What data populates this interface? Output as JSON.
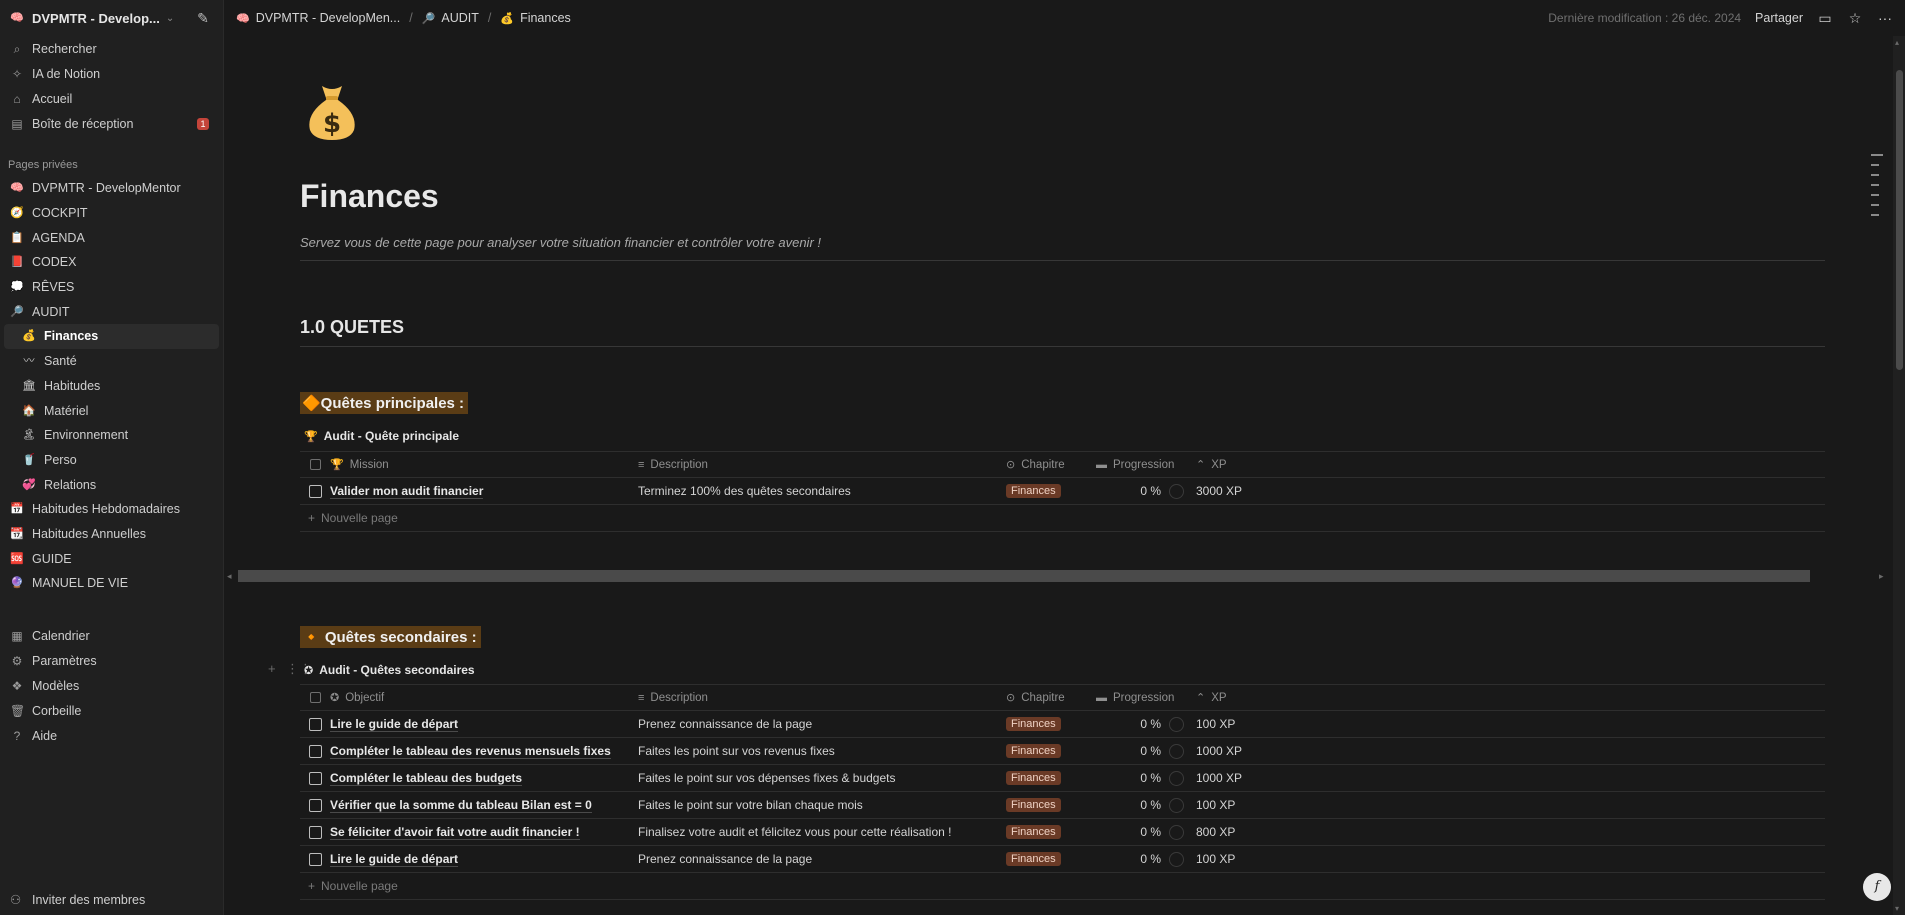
{
  "workspace": {
    "name": "DVPMTR - Develop...",
    "icon": "brain-icon"
  },
  "sidebar": {
    "top_items": [
      {
        "label": "Rechercher",
        "icon": "search-icon"
      },
      {
        "label": "IA de Notion",
        "icon": "ai-icon"
      },
      {
        "label": "Accueil",
        "icon": "home-icon"
      },
      {
        "label": "Boîte de réception",
        "icon": "inbox-icon",
        "badge": "1"
      }
    ],
    "section_label": "Pages privées",
    "tree": [
      {
        "label": "DVPMTR - DevelopMentor",
        "emoji": "🧠",
        "level": 0
      },
      {
        "label": "COCKPIT",
        "emoji": "🧭",
        "level": 1
      },
      {
        "label": "AGENDA",
        "emoji": "📋",
        "level": 1
      },
      {
        "label": "CODEX",
        "emoji": "📕",
        "level": 1
      },
      {
        "label": "RÊVES",
        "emoji": "💭",
        "level": 1
      },
      {
        "label": "AUDIT",
        "emoji": "🔎",
        "level": 1
      },
      {
        "label": "Finances",
        "emoji": "💰",
        "level": 2,
        "active": true
      },
      {
        "label": "Santé",
        "emoji": "〰",
        "level": 2
      },
      {
        "label": "Habitudes",
        "emoji": "🏛",
        "level": 2
      },
      {
        "label": "Matériel",
        "emoji": "🏠",
        "level": 2
      },
      {
        "label": "Environnement",
        "emoji": "🏝",
        "level": 2
      },
      {
        "label": "Perso",
        "emoji": "🥤",
        "level": 2
      },
      {
        "label": "Relations",
        "emoji": "💞",
        "level": 2
      },
      {
        "label": "Habitudes Hebdomadaires",
        "emoji": "📅",
        "level": 1
      },
      {
        "label": "Habitudes Annuelles",
        "emoji": "📆",
        "level": 1
      },
      {
        "label": "GUIDE",
        "emoji": "🆘",
        "level": 1
      },
      {
        "label": "MANUEL DE VIE",
        "emoji": "🔮",
        "level": 1
      }
    ],
    "bottom_items": [
      {
        "label": "Calendrier",
        "icon": "calendar-icon"
      },
      {
        "label": "Paramètres",
        "icon": "settings-icon"
      },
      {
        "label": "Modèles",
        "icon": "templates-icon"
      },
      {
        "label": "Corbeille",
        "icon": "trash-icon"
      },
      {
        "label": "Aide",
        "icon": "help-icon"
      }
    ],
    "invite": "Inviter des membres"
  },
  "topbar": {
    "breadcrumbs": [
      {
        "label": "DVPMTR - DevelopMen...",
        "emoji": "🧠"
      },
      {
        "label": "AUDIT",
        "emoji": "🔎"
      },
      {
        "label": "Finances",
        "emoji": "💰"
      }
    ],
    "last_modified": "Dernière modification : 26 déc. 2024",
    "share": "Partager"
  },
  "page": {
    "icon": "money-bag-icon",
    "title": "Finances",
    "subtitle": "Servez vous de cette page pour analyser votre situation financier et contrôler votre avenir !",
    "section_heading": "1.0 QUETES",
    "main_quests": {
      "heading": "🔶Quêtes principales :",
      "db_title": "Audit - Quête principale",
      "columns": {
        "name": "Mission",
        "description": "Description",
        "chapter": "Chapitre",
        "progress": "Progression",
        "xp": "XP"
      },
      "rows": [
        {
          "name": "Valider mon audit financier",
          "description": "Terminez 100% des quêtes secondaires",
          "chapter": "Finances",
          "progress": "0 %",
          "xp": "3000 XP"
        }
      ],
      "new_page": "Nouvelle page"
    },
    "side_quests": {
      "heading": "🔸 Quêtes secondaires :",
      "db_title": "Audit - Quêtes secondaires",
      "columns": {
        "name": "Objectif",
        "description": "Description",
        "chapter": "Chapitre",
        "progress": "Progression",
        "xp": "XP"
      },
      "rows": [
        {
          "name": "Lire le guide de départ",
          "description": "Prenez connaissance de la page",
          "chapter": "Finances",
          "progress": "0 %",
          "xp": "100 XP"
        },
        {
          "name": "Compléter le tableau des revenus mensuels fixes",
          "description": "Faites les point sur vos revenus fixes",
          "chapter": "Finances",
          "progress": "0 %",
          "xp": "1000 XP"
        },
        {
          "name": "Compléter le tableau des budgets",
          "description": "Faites le point sur vos dépenses fixes & budgets",
          "chapter": "Finances",
          "progress": "0 %",
          "xp": "1000 XP"
        },
        {
          "name": "Vérifier que la somme du tableau Bilan est = 0",
          "description": "Faites le point sur votre bilan chaque mois",
          "chapter": "Finances",
          "progress": "0 %",
          "xp": "100 XP"
        },
        {
          "name": "Se féliciter d'avoir fait votre audit financier !",
          "description": "Finalisez votre audit et félicitez vous pour cette réalisation !",
          "chapter": "Finances",
          "progress": "0 %",
          "xp": "800 XP"
        },
        {
          "name": "Lire le guide de départ",
          "description": "Prenez connaissance de la page",
          "chapter": "Finances",
          "progress": "0 %",
          "xp": "100 XP"
        }
      ],
      "new_page": "Nouvelle page"
    }
  },
  "colors": {
    "background": "#191919",
    "sidebar": "#202020",
    "tag": "#6a3a26",
    "highlight": "#5a3c15",
    "badge": "#c4443a"
  }
}
